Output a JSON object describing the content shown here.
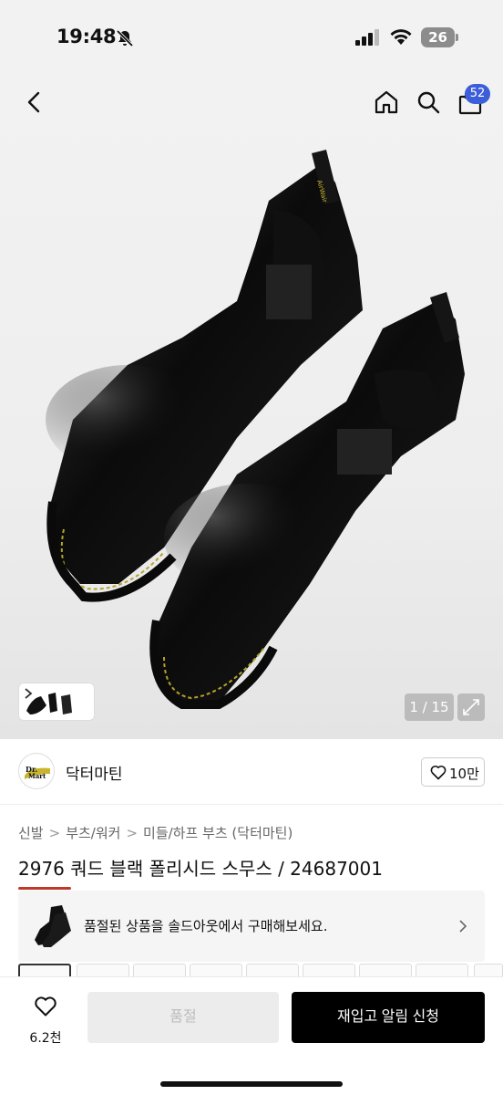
{
  "status": {
    "time": "19:48",
    "battery": "26"
  },
  "nav": {
    "cart_count": "52"
  },
  "gallery": {
    "counter": "1 / 15"
  },
  "brand": {
    "name": "닥터마틴",
    "likes": "10만"
  },
  "breadcrumb": {
    "items": [
      "신발",
      "부츠/워커",
      "미들/하프 부츠 (닥터마틴)"
    ],
    "separator": ">"
  },
  "product": {
    "title": "2976 쿼드 블랙 폴리시드 스무스 / 24687001"
  },
  "banner": {
    "text": "품절된 상품을 솔드아웃에서 구매해보세요."
  },
  "bottom": {
    "wish_count": "6.2천",
    "soldout_label": "품절",
    "restock_label": "재입고 알림 신청"
  },
  "colors": {
    "accent": "#3c5ed8",
    "primary_button": "#000000",
    "disabled_button": "#ececec"
  }
}
